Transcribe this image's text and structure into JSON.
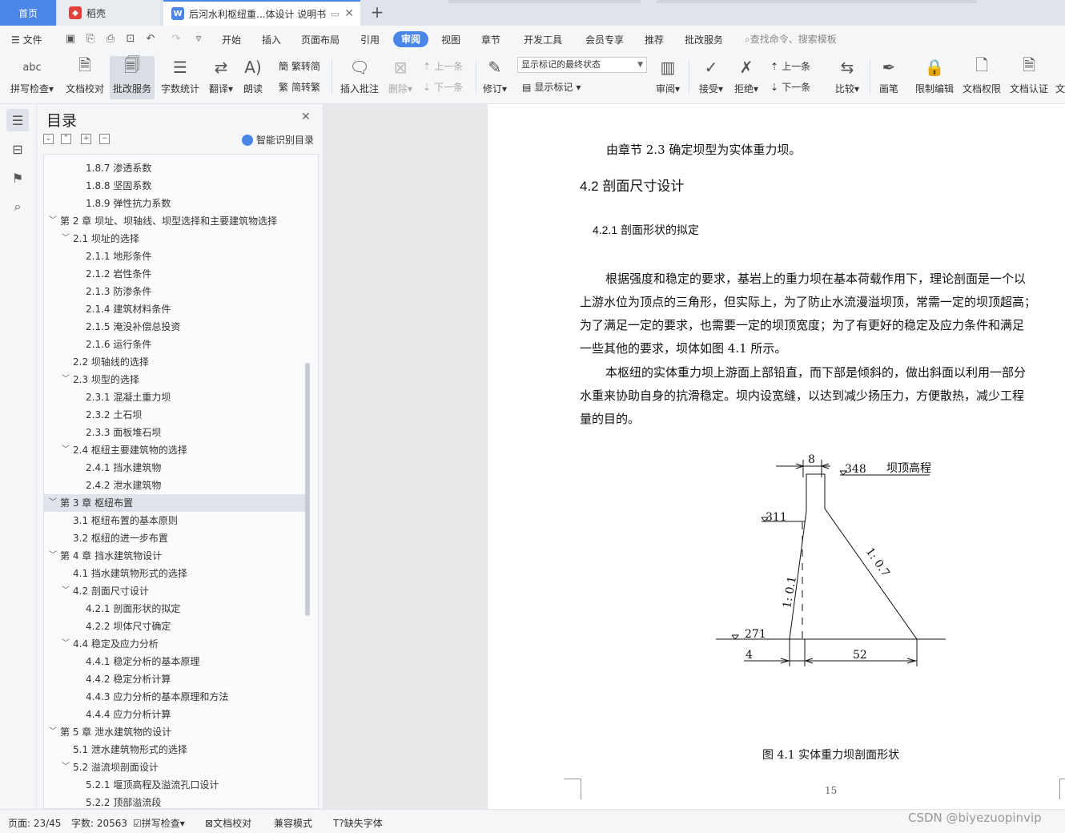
{
  "tabs": {
    "home": "首页",
    "daoke": "稻壳",
    "document": "后河水利枢纽重...体设计 说明书"
  },
  "menu": {
    "file": "文件",
    "items": [
      "开始",
      "插入",
      "页面布局",
      "引用",
      "审阅",
      "视图",
      "章节",
      "开发工具",
      "会员专享",
      "推荐",
      "批改服务"
    ],
    "active": "审阅",
    "search_placeholder": "查找命令、搜索模板"
  },
  "ribbon": {
    "spell_check": "拼写检查",
    "doc_proof": "文档校对",
    "correction_service": "批改服务",
    "word_count": "字数统计",
    "translate": "翻译",
    "read_aloud": "朗读",
    "trad_to_simp": "繁转简",
    "simp_to_trad": "简转繁",
    "insert_comment": "插入批注",
    "delete": "删除",
    "prev_comment": "上一条",
    "next_comment": "下一条",
    "revise": "修订",
    "markup_state": "显示标记的最终状态",
    "show_markup": "显示标记",
    "review": "审阅",
    "accept": "接受",
    "reject": "拒绝",
    "prev_change": "上一条",
    "next_change": "下一条",
    "compare": "比较",
    "pen": "画笔",
    "restrict_edit": "限制编辑",
    "doc_permission": "文档权限",
    "doc_cert": "文档认证",
    "doc_more": "文"
  },
  "toc": {
    "title": "目录",
    "smart_label": "智能识别目录",
    "items": [
      {
        "text": "1.8.7  渗透系数",
        "level": 3,
        "caret": ""
      },
      {
        "text": "1.8.8  坚固系数",
        "level": 3,
        "caret": ""
      },
      {
        "text": "1.8.9  弹性抗力系数",
        "level": 3,
        "caret": ""
      },
      {
        "text": "第 2 章  坝址、坝轴线、坝型选择和主要建筑物选择",
        "level": 1,
        "caret": "﹀"
      },
      {
        "text": "2.1  坝址的选择",
        "level": 2,
        "caret": "﹀"
      },
      {
        "text": "2.1.1  地形条件",
        "level": 3,
        "caret": ""
      },
      {
        "text": "2.1.2 岩性条件",
        "level": 3,
        "caret": ""
      },
      {
        "text": "2.1.3 防渗条件",
        "level": 3,
        "caret": ""
      },
      {
        "text": "2.1.4 建筑材料条件",
        "level": 3,
        "caret": ""
      },
      {
        "text": "2.1.5 淹没补偿总投资",
        "level": 3,
        "caret": ""
      },
      {
        "text": "2.1.6 运行条件",
        "level": 3,
        "caret": ""
      },
      {
        "text": "2.2 坝轴线的选择",
        "level": 2,
        "caret": ""
      },
      {
        "text": "2.3  坝型的选择",
        "level": 2,
        "caret": "﹀"
      },
      {
        "text": "2.3.1  混凝土重力坝",
        "level": 3,
        "caret": ""
      },
      {
        "text": "2.3.2  土石坝",
        "level": 3,
        "caret": ""
      },
      {
        "text": "2.3.3  面板堆石坝",
        "level": 3,
        "caret": ""
      },
      {
        "text": "2.4  枢纽主要建筑物的选择",
        "level": 2,
        "caret": "﹀"
      },
      {
        "text": "2.4.1 挡水建筑物",
        "level": 3,
        "caret": ""
      },
      {
        "text": "2.4.2 泄水建筑物",
        "level": 3,
        "caret": ""
      },
      {
        "text": "第 3 章  枢纽布置",
        "level": 1,
        "caret": "﹀",
        "selected": true
      },
      {
        "text": "3.1  枢纽布置的基本原则",
        "level": 2,
        "caret": ""
      },
      {
        "text": "3.2  枢纽的进一步布置",
        "level": 2,
        "caret": ""
      },
      {
        "text": "第 4 章  挡水建筑物设计",
        "level": 1,
        "caret": "﹀"
      },
      {
        "text": "4.1  挡水建筑物形式的选择",
        "level": 2,
        "caret": ""
      },
      {
        "text": "4.2  剖面尺寸设计",
        "level": 2,
        "caret": "﹀"
      },
      {
        "text": "4.2.1 剖面形状的拟定",
        "level": 3,
        "caret": ""
      },
      {
        "text": "4.2.2  坝体尺寸确定",
        "level": 3,
        "caret": ""
      },
      {
        "text": "4.4  稳定及应力分析",
        "level": 2,
        "caret": "﹀"
      },
      {
        "text": "4.4.1  稳定分析的基本原理",
        "level": 3,
        "caret": ""
      },
      {
        "text": "4.4.2  稳定分析计算",
        "level": 3,
        "caret": ""
      },
      {
        "text": "4.4.3  应力分析的基本原理和方法",
        "level": 3,
        "caret": ""
      },
      {
        "text": "4.4.4  应力分析计算",
        "level": 3,
        "caret": ""
      },
      {
        "text": "第 5 章  泄水建筑物的设计",
        "level": 1,
        "caret": "﹀"
      },
      {
        "text": "5.1  泄水建筑物形式的选择",
        "level": 2,
        "caret": ""
      },
      {
        "text": "5.2  溢流坝剖面设计",
        "level": 2,
        "caret": "﹀"
      },
      {
        "text": "5.2.1  堰顶高程及溢流孔口设计",
        "level": 3,
        "caret": ""
      },
      {
        "text": "5.2.2  顶部溢流段",
        "level": 3,
        "caret": ""
      }
    ]
  },
  "document": {
    "intro": "由章节 2.3 确定坝型为实体重力坝。",
    "heading_42": "4.2  剖面尺寸设计",
    "heading_421": "4.2.1 剖面形状的拟定",
    "para_lines": [
      "根据强度和稳定的要求，基岩上的重力坝在基本荷载作用下，理论剖面是一个以",
      "上游水位为顶点的三角形，但实际上，为了防止水流漫溢坝顶，常需一定的坝顶超高；",
      "为了满足一定的要求，也需要一定的坝顶宽度；为了有更好的稳定及应力条件和满足",
      "一些其他的要求，坝体如图 4.1 所示。",
      "本枢纽的实体重力坝上游面上部铅直，而下部是倾斜的，做出斜面以利用一部分",
      "水重来协助自身的抗滑稳定。坝内设宽缝，以达到减少扬压力，方便散热，减少工程",
      "量的目的。"
    ],
    "figure": {
      "crest_width": "8",
      "crest_elev": "348",
      "crest_label": "坝顶高程",
      "break_elev": "311",
      "base_elev": "271",
      "upstream_slope": "1: 0.1",
      "downstream_slope": "1: 0.7",
      "toe_width": "4",
      "base_width": "52"
    },
    "caption": "图 4.1  实体重力坝剖面形状",
    "page_number": "15"
  },
  "status": {
    "page": "页面: 23/45",
    "words": "字数: 20563",
    "spell": "拼写检查",
    "proof": "文档校对",
    "compat": "兼容模式",
    "missing_font": "缺失字体"
  },
  "watermark": "CSDN @biyezuopinvip",
  "colors": {
    "accent": "#4a86e8",
    "wps_red": "#e0413a"
  }
}
